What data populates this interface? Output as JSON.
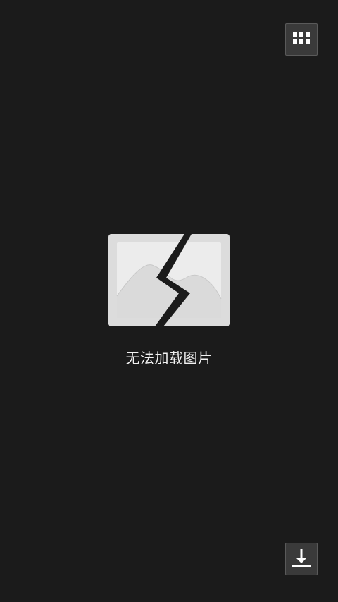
{
  "viewer": {
    "error_message": "无法加载图片"
  },
  "toolbar": {
    "grid_icon": "grid-icon",
    "download_icon": "download-icon"
  },
  "colors": {
    "background": "#1b1b1b",
    "button_bg": "#3a3a3a",
    "button_border": "#5a5a5a",
    "placeholder_frame": "#dcdcdc",
    "placeholder_inner": "#ececec",
    "text": "#f2f2f2"
  }
}
